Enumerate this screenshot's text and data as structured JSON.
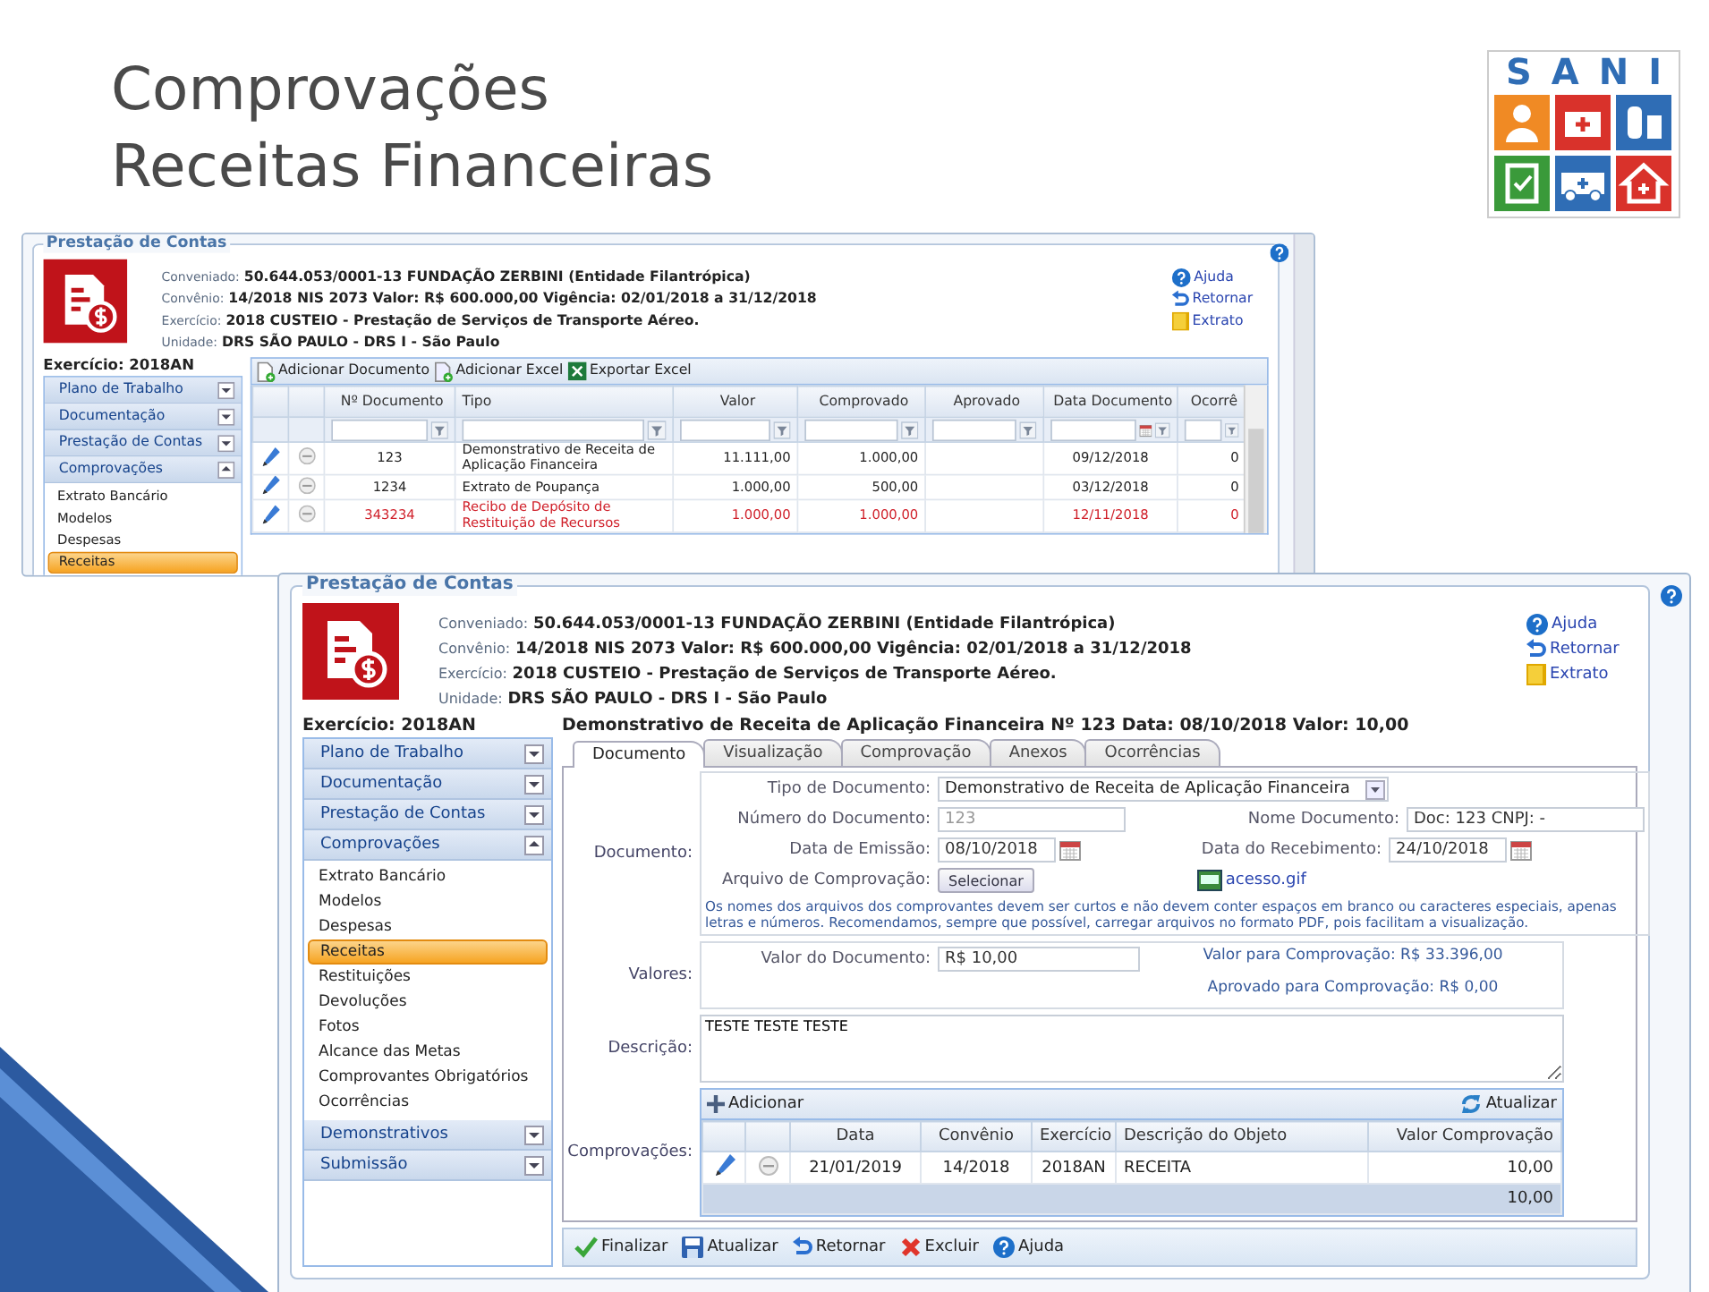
{
  "slide": {
    "title_lines": [
      "Comprovações",
      "Receitas Financeiras"
    ],
    "logo": {
      "text": "SANI"
    }
  },
  "back_window": {
    "legend": "Prestação de Contas",
    "info": [
      {
        "label": "Conveniado:",
        "value": "50.644.053/0001-13 FUNDAÇÃO ZERBINI (Entidade Filantrópica)"
      },
      {
        "label": "Convênio:",
        "value": "14/2018 NIS 2073 Valor: R$ 600.000,00 Vigência: 02/01/2018 a 31/12/2018"
      },
      {
        "label": "Exercício:",
        "value": "2018 CUSTEIO - Prestação de Serviços de Transporte Aéreo."
      },
      {
        "label": "Unidade:",
        "value": "DRS SÃO PAULO - DRS I - São Paulo"
      }
    ],
    "links": [
      {
        "label": "Ajuda",
        "kind": "help"
      },
      {
        "label": "Retornar",
        "kind": "back"
      },
      {
        "label": "Extrato",
        "kind": "book"
      }
    ],
    "sidebar": {
      "title": "Exercício: 2018AN",
      "sections": [
        {
          "label": "Plano de Trabalho",
          "expanded": false
        },
        {
          "label": "Documentação",
          "expanded": false
        },
        {
          "label": "Prestação de Contas",
          "expanded": false
        },
        {
          "label": "Comprovações",
          "expanded": true,
          "items": [
            {
              "label": "Extrato Bancário",
              "selected": false
            },
            {
              "label": "Modelos",
              "selected": false
            },
            {
              "label": "Despesas",
              "selected": false
            },
            {
              "label": "Receitas",
              "selected": true
            }
          ]
        }
      ]
    },
    "toolbar": [
      {
        "label": "Adicionar Documento",
        "kind": "doc-add"
      },
      {
        "label": "Adicionar Excel",
        "kind": "excel-add"
      },
      {
        "label": "Exportar Excel",
        "kind": "excel"
      }
    ],
    "table": {
      "columns": [
        "Nº Documento",
        "Tipo",
        "Valor",
        "Comprovado",
        "Aprovado",
        "Data Documento",
        "Ocorrê"
      ],
      "rows": [
        {
          "cells": [
            "123",
            "Demonstrativo de Receita de Aplicação Financeira",
            "11.111,00",
            "1.000,00",
            null,
            "09/12/2018",
            "0"
          ],
          "flagged": false
        },
        {
          "cells": [
            "1234",
            "Extrato de Poupança",
            "1.000,00",
            "500,00",
            null,
            "03/12/2018",
            "0"
          ],
          "flagged": false
        },
        {
          "cells": [
            "343234",
            "Recibo de Depósito de Restituição de Recursos",
            "1.000,00",
            "1.000,00",
            null,
            "12/11/2018",
            "0"
          ],
          "flagged": true
        }
      ]
    }
  },
  "front_window": {
    "legend": "Prestação de Contas",
    "info": [
      {
        "label": "Conveniado:",
        "value": "50.644.053/0001-13 FUNDAÇÃO ZERBINI (Entidade Filantrópica)"
      },
      {
        "label": "Convênio:",
        "value": "14/2018 NIS 2073 Valor: R$ 600.000,00 Vigência: 02/01/2018 a 31/12/2018"
      },
      {
        "label": "Exercício:",
        "value": "2018 CUSTEIO - Prestação de Serviços de Transporte Aéreo."
      },
      {
        "label": "Unidade:",
        "value": "DRS SÃO PAULO - DRS I - São Paulo"
      }
    ],
    "links": [
      {
        "label": "Ajuda",
        "kind": "help"
      },
      {
        "label": "Retornar",
        "kind": "back"
      },
      {
        "label": "Extrato",
        "kind": "book"
      }
    ],
    "sidebar": {
      "title": "Exercício: 2018AN",
      "sections": [
        {
          "label": "Plano de Trabalho",
          "expanded": false
        },
        {
          "label": "Documentação",
          "expanded": false
        },
        {
          "label": "Prestação de Contas",
          "expanded": false
        },
        {
          "label": "Comprovações",
          "expanded": true,
          "items": [
            {
              "label": "Extrato Bancário",
              "selected": false
            },
            {
              "label": "Modelos",
              "selected": false
            },
            {
              "label": "Despesas",
              "selected": false
            },
            {
              "label": "Receitas",
              "selected": true
            },
            {
              "label": "Restituições",
              "selected": false
            },
            {
              "label": "Devoluções",
              "selected": false
            },
            {
              "label": "Fotos",
              "selected": false
            },
            {
              "label": "Alcance das Metas",
              "selected": false
            },
            {
              "label": "Comprovantes Obrigatórios",
              "selected": false
            },
            {
              "label": "Ocorrências",
              "selected": false
            }
          ]
        },
        {
          "label": "Demonstrativos",
          "expanded": false
        },
        {
          "label": "Submissão",
          "expanded": false
        }
      ]
    },
    "document": {
      "heading": "Demonstrativo de Receita de Aplicação Financeira Nº 123 Data: 08/10/2018 Valor: 10,00",
      "tabs": [
        {
          "label": "Documento",
          "selected": true
        },
        {
          "label": "Visualização",
          "selected": false
        },
        {
          "label": "Comprovação",
          "selected": false
        },
        {
          "label": "Anexos",
          "selected": false
        },
        {
          "label": "Ocorrências",
          "selected": false
        }
      ],
      "documento_group": {
        "label": "Documento:",
        "tipo": {
          "label": "Tipo de Documento:",
          "value": "Demonstrativo de Receita de Aplicação Financeira"
        },
        "numero": {
          "label": "Número do Documento:",
          "value": "123",
          "disabled": true
        },
        "nome": {
          "label": "Nome Documento:",
          "value": "Doc: 123 CNPJ: -",
          "disabled": false
        },
        "emissao": {
          "label": "Data de Emissão:",
          "value": "08/10/2018"
        },
        "recebimento": {
          "label": "Data do Recebimento:",
          "value": "24/10/2018"
        },
        "arquivo": {
          "label": "Arquivo de Comprovação:",
          "button": "Selecionar",
          "file": "acesso.gif"
        },
        "note": "Os nomes dos arquivos dos comprovantes devem ser curtos e não devem conter espaços em branco ou caracteres especiais, apenas letras e números. Recomendamos, sempre que possível, carregar arquivos no formato PDF, pois facilitam a visualização."
      },
      "valores_group": {
        "label": "Valores:",
        "valor_documento": {
          "label": "Valor do Documento:",
          "value": "R$ 10,00"
        },
        "summary": [
          "Valor para Comprovação: R$ 33.396,00",
          "Aprovado para Comprovação: R$ 0,00"
        ]
      },
      "descricao": {
        "label": "Descrição:",
        "value": "TESTE TESTE TESTE"
      },
      "comprovacoes": {
        "label": "Comprovações:",
        "toolbar": [
          {
            "label": "Adicionar",
            "kind": "add"
          },
          {
            "label": "Atualizar",
            "kind": "refresh"
          }
        ],
        "columns": [
          "Data",
          "Convênio",
          "Exercício",
          "Descrição do Objeto",
          "Valor Comprovação"
        ],
        "rows": [
          {
            "cells": [
              "21/01/2019",
              "14/2018",
              "2018AN",
              "RECEITA",
              "10,00"
            ]
          }
        ],
        "total": "10,00"
      },
      "actions": [
        {
          "label": "Finalizar",
          "kind": "finish"
        },
        {
          "label": "Atualizar",
          "kind": "save"
        },
        {
          "label": "Retornar",
          "kind": "back"
        },
        {
          "label": "Excluir",
          "kind": "delete"
        },
        {
          "label": "Ajuda",
          "kind": "help"
        }
      ]
    }
  }
}
